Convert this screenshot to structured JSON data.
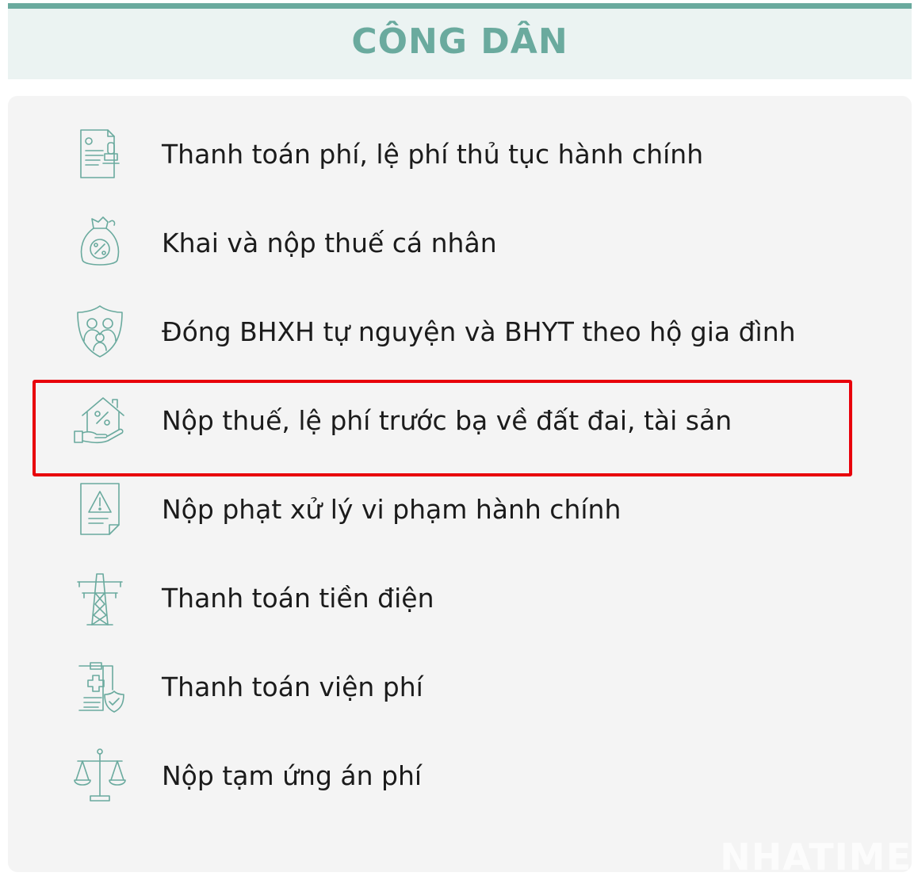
{
  "header": {
    "title": "CÔNG DÂN"
  },
  "services": [
    {
      "label": "Thanh toán phí, lệ phí thủ tục hành chính",
      "icon": "document-stamp-icon"
    },
    {
      "label": "Khai và nộp thuế cá nhân",
      "icon": "money-bag-percent-icon"
    },
    {
      "label": "Đóng BHXH tự nguyện và BHYT theo hộ gia đình",
      "icon": "family-shield-icon"
    },
    {
      "label": "Nộp thuế, lệ phí trước bạ về đất đai, tài sản",
      "icon": "house-hand-percent-icon",
      "highlighted": true
    },
    {
      "label": "Nộp phạt xử lý vi phạm hành chính",
      "icon": "document-warning-icon"
    },
    {
      "label": "Thanh toán tiền điện",
      "icon": "power-tower-icon"
    },
    {
      "label": "Thanh toán viện phí",
      "icon": "medical-clipboard-shield-icon"
    },
    {
      "label": "Nộp tạm ứng án phí",
      "icon": "scales-of-justice-icon"
    }
  ],
  "watermark": "NHATIME",
  "colors": {
    "accent": "#6aaa9e",
    "highlight": "#e8000b",
    "panel": "#f4f4f4"
  }
}
